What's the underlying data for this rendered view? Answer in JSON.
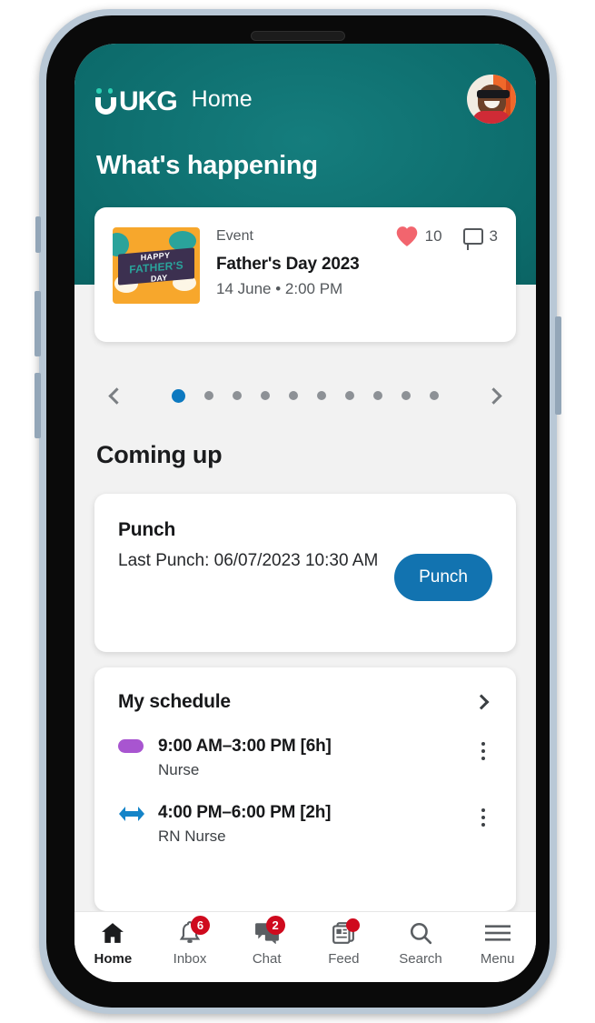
{
  "app": {
    "brand": "UKG",
    "brand_logo_icon": "ukg-logo",
    "header_title": "Home",
    "avatar_icon": "user-avatar",
    "section_heading": "What's happening",
    "teal_dark": "#064f4f",
    "teal_light": "#157d7d",
    "accent_blue": "#1273b0",
    "badge_red": "#cf0a1e"
  },
  "event_card": {
    "thumb_icon": "fathers-day-thumbnail",
    "thumb_text_line1": "HAPPY",
    "thumb_text_line2": "FATHER'S",
    "thumb_text_line3": "DAY",
    "kicker": "Event",
    "title": "Father's Day 2023",
    "meta": "14 June • 2:00 PM",
    "like_icon": "heart-icon",
    "like_count": "10",
    "comment_icon": "comment-icon",
    "comment_count": "3"
  },
  "carousel": {
    "prev_icon": "chevron-left-icon",
    "next_icon": "chevron-right-icon",
    "total_dots": 10,
    "active_index": 0
  },
  "coming_up": {
    "heading": "Coming up",
    "punch": {
      "title": "Punch",
      "last_punch": "Last Punch: 06/07/2023 10:30 AM",
      "button_label": "Punch"
    },
    "schedule": {
      "title": "My schedule",
      "more_icon": "chevron-right-icon",
      "rows": [
        {
          "marker_icon": "purple-pill-icon",
          "time": "9:00 AM–3:00 PM [6h]",
          "role": "Nurse",
          "menu_icon": "kebab-menu-icon"
        },
        {
          "marker_icon": "swap-arrows-icon",
          "time": "4:00 PM–6:00 PM [2h]",
          "role": "RN Nurse",
          "menu_icon": "kebab-menu-icon"
        }
      ]
    }
  },
  "bottom_nav": {
    "items": [
      {
        "label": "Home",
        "icon": "home-icon",
        "badge": "",
        "active": true
      },
      {
        "label": "Inbox",
        "icon": "bell-icon",
        "badge": "6",
        "active": false
      },
      {
        "label": "Chat",
        "icon": "chat-icon",
        "badge": "2",
        "active": false
      },
      {
        "label": "Feed",
        "icon": "feed-icon",
        "badge": "•",
        "active": false
      },
      {
        "label": "Search",
        "icon": "search-icon",
        "badge": "",
        "active": false
      },
      {
        "label": "Menu",
        "icon": "hamburger-menu-icon",
        "badge": "",
        "active": false
      }
    ]
  }
}
